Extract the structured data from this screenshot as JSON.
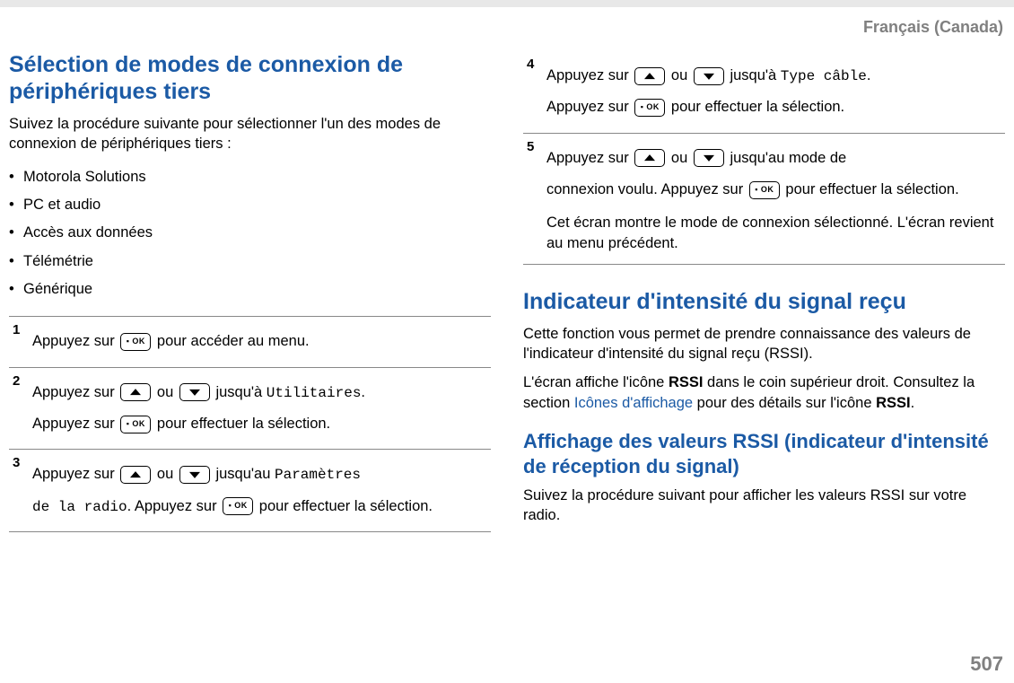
{
  "header": {
    "language": "Français (Canada)"
  },
  "page_number": "507",
  "left": {
    "title": "Sélection de modes de connexion de périphériques tiers",
    "intro": "Suivez la procédure suivante pour sélectionner l'un des modes de connexion de périphériques tiers :",
    "bullets": [
      "Motorola Solutions",
      "PC et audio",
      "Accès aux données",
      "Télémétrie",
      "Générique"
    ],
    "steps": {
      "s1": {
        "num": "1",
        "t1a": "Appuyez sur ",
        "t1b": " pour accéder au menu."
      },
      "s2": {
        "num": "2",
        "t1a": "Appuyez sur ",
        "t1b": " ou ",
        "t1c": " jusqu'à ",
        "menu": "Utilitaires",
        "t1d": ".",
        "t2a": "Appuyez sur ",
        "t2b": " pour effectuer la sélection."
      },
      "s3": {
        "num": "3",
        "t1a": "Appuyez sur ",
        "t1b": " ou ",
        "t1c": " jusqu'au ",
        "menu1": "Paramètres",
        "menu2": "de la radio",
        "t2a": ". Appuyez sur ",
        "t2b": " pour effectuer la sélection."
      }
    }
  },
  "right": {
    "steps": {
      "s4": {
        "num": "4",
        "t1a": "Appuyez sur ",
        "t1b": " ou ",
        "t1c": " jusqu'à ",
        "menu": "Type câble",
        "t1d": ".",
        "t2a": "Appuyez sur ",
        "t2b": " pour effectuer la sélection."
      },
      "s5": {
        "num": "5",
        "t1a": "Appuyez sur ",
        "t1b": " ou ",
        "t1c": " jusqu'au mode de",
        "t2a": "connexion voulu. Appuyez sur ",
        "t2b": " pour effectuer la sélection.",
        "note": "Cet écran montre le mode de connexion sélectionné. L'écran revient au menu précédent."
      }
    },
    "rssi": {
      "title": "Indicateur d'intensité du signal reçu",
      "p1": "Cette fonction vous permet de prendre connaissance des valeurs de l'indicateur d'intensité du signal reçu (RSSI).",
      "p2a": "L'écran affiche l'icône ",
      "p2b": "RSSI",
      "p2c": " dans le coin supérieur droit. Consultez la section ",
      "link": "Icônes d'affichage",
      "p2d": " pour des détails sur l'icône ",
      "p2e": "RSSI",
      "p2f": "."
    },
    "rssi2": {
      "title": "Affichage des valeurs RSSI (indicateur d'intensité de réception du signal)",
      "p1": "Suivez la procédure suivant pour afficher les valeurs RSSI sur votre radio."
    }
  }
}
